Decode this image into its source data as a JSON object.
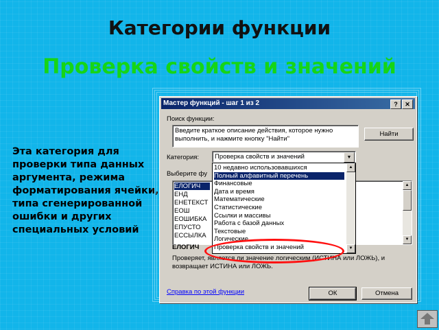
{
  "slide": {
    "title": "Категории функции",
    "subtitle": "Проверка свойств и значений",
    "description": "Эта категория для проверки типа данных аргумента, режима форматирования ячейки, типа сгенерированной ошибки и других специальных условий"
  },
  "dialog": {
    "title": "Мастер функций - шаг 1 из 2",
    "help_btn": "?",
    "close_btn": "✕",
    "search_label": "Поиск функции:",
    "search_value": "Введите краткое описание действия, которое нужно выполнить, и нажмите кнопку \"Найти\"",
    "find_button": "Найти",
    "category_label": "Категория:",
    "category_value": "Проверка свойств и значений",
    "select_label": "Выберите фу",
    "category_options": [
      "10 недавно использовавшихся",
      "Полный алфавитный перечень",
      "Финансовые",
      "Дата и время",
      "Математические",
      "Статистические",
      "Ссылки и массивы",
      "Работа с базой данных",
      "Текстовые",
      "Логические",
      "Проверка свойств и значений"
    ],
    "selected_option_index": 1,
    "functions": [
      "ЕЛОГИЧ",
      "ЕНД",
      "ЕНЕТЕКСТ",
      "ЕОШ",
      "ЕОШИБКА",
      "ЕПУСТО",
      "ЕССЫЛКА"
    ],
    "func_name": "ЕЛОГИЧ",
    "func_desc_1": "Проверяет, является ли значение логическим (ИСТИНА или ЛОЖЬ), и",
    "func_desc_2": "возвращает ИСТИНА или ЛОЖЬ.",
    "help_link": "Справка по этой функции",
    "ok_button": "ОК",
    "cancel_button": "Отмена"
  },
  "colors": {
    "background": "#12b5ea",
    "subtitle": "#16d516",
    "highlight": "#ff1010",
    "selection": "#0a246a"
  }
}
